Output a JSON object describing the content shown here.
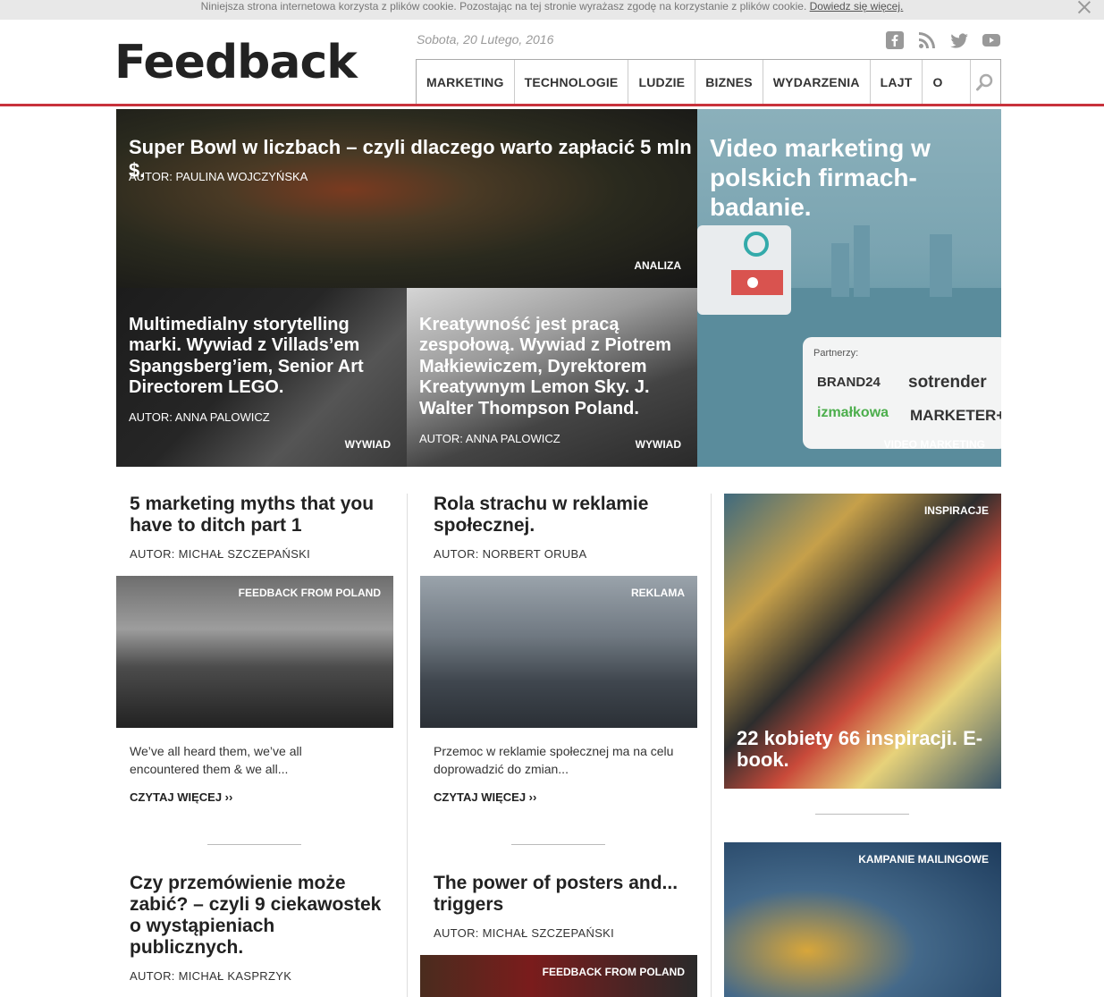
{
  "cookie": {
    "text": "Niniejsza strona internetowa korzysta z plików cookie. Pozostając na tej stronie wyrażasz zgodę na korzystanie z plików cookie.",
    "link": "Dowiedz się więcej."
  },
  "header": {
    "logo": "Feedback",
    "date": "Sobota, 20 Lutego, 2016"
  },
  "nav": {
    "items": [
      "MARKETING",
      "TECHNOLOGIE",
      "LUDZIE",
      "BIZNES",
      "WYDARZENIA",
      "LAJT",
      "O NAS"
    ]
  },
  "hero": {
    "main": {
      "title": "Super Bowl w liczbach – czyli dlaczego warto zapłacić 5 mln $.",
      "author": "AUTOR: PAULINA WOJCZYŃSKA",
      "category": "ANALIZA"
    },
    "side": {
      "title": "Video marketing w polskich firmach- badanie.",
      "category": "VIDEO MARKETING",
      "partners_label": "Partnerzy:",
      "partners": [
        "BRAND24",
        "sotrender",
        "izmałkowa",
        "MARKETER+"
      ]
    },
    "left": {
      "title": "Multimedialny storytelling marki. Wywiad z Villads’em Spangsberg’iem, Senior Art Directorem LEGO.",
      "author": "AUTOR: ANNA PALOWICZ",
      "category": "WYWIAD"
    },
    "mid": {
      "title": "Kreatywność jest pracą zespołową. Wywiad z Piotrem Małkiewiczem, Dyrektorem Kreatywnym Lemon Sky. J. Walter Thompson Poland.",
      "author": "AUTOR: ANNA PALOWICZ",
      "category": "WYWIAD"
    }
  },
  "col1": {
    "a1": {
      "title": "5 marketing myths that you have to ditch part 1",
      "author": "AUTOR: MICHAŁ SZCZEPAŃSKI",
      "category": "FEEDBACK FROM POLAND",
      "excerpt": "We’ve all heard them, we’ve all encountered them & we all...",
      "more": "CZYTAJ WIĘCEJ ››"
    },
    "a2": {
      "title": "Czy przemówienie może zabić? – czyli 9 ciekawostek o wystąpieniach publicznych.",
      "author": "AUTOR: MICHAŁ KASPRZYK"
    }
  },
  "col2": {
    "a1": {
      "title": "Rola strachu w reklamie społecznej.",
      "author": "AUTOR: NORBERT ORUBA",
      "category": "REKLAMA",
      "excerpt": "Przemoc w reklamie społecznej ma na celu doprowadzić do zmian...",
      "more": "CZYTAJ WIĘCEJ ››"
    },
    "a2": {
      "title": "The power of posters and... triggers",
      "author": "AUTOR: MICHAŁ SZCZEPAŃSKI",
      "category": "FEEDBACK FROM POLAND"
    }
  },
  "col3": {
    "a1": {
      "title": "22 kobiety 66 inspiracji. E-book.",
      "category": "INSPIRACJE"
    },
    "a2": {
      "category": "KAMPANIE MAILINGOWE"
    }
  }
}
